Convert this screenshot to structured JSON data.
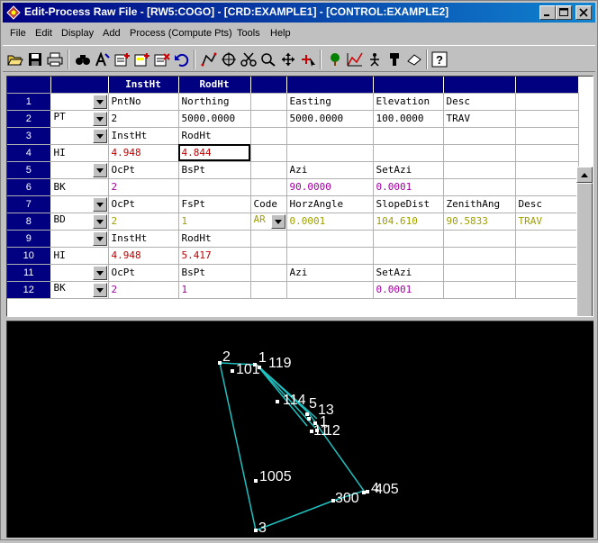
{
  "window": {
    "title": "Edit-Process Raw File - [RW5:COGO] - [CRD:EXAMPLE1] - [CONTROL:EXAMPLE2]"
  },
  "menu": [
    "File",
    "Edit",
    "Display",
    "Add",
    "Process (Compute Pts)",
    "Tools",
    "Help"
  ],
  "toolbar": [
    "open-folder-icon",
    "save-disk-icon",
    "print-icon",
    "binoculars-find-icon",
    "find-replace-icon",
    "insert-record-icon",
    "new-record-icon",
    "delete-record-icon",
    "undo-icon",
    "traverse-icon",
    "target-icon",
    "scissors-icon",
    "zoom-window-icon",
    "pan-icon",
    "pick-point-icon",
    "tree-icon",
    "process-icon",
    "person-icon",
    "rod-icon",
    "eraser-icon",
    "help-icon"
  ],
  "grid": {
    "header": [
      "",
      "",
      "InstHt",
      "RodHt",
      "",
      "",
      "",
      "",
      ""
    ],
    "rows": [
      {
        "num": "1",
        "type": "",
        "color": "black",
        "dd": true,
        "cells": [
          "PntNo",
          "Northing",
          "",
          "Easting",
          "Elevation",
          "Desc",
          ""
        ]
      },
      {
        "num": "2",
        "type": "PT",
        "color": "black",
        "dd": true,
        "cells": [
          "2",
          "5000.0000",
          "",
          "5000.0000",
          "100.0000",
          "TRAV",
          ""
        ]
      },
      {
        "num": "3",
        "type": "",
        "color": "black",
        "dd": true,
        "cells": [
          "InstHt",
          "RodHt",
          "",
          "",
          "",
          "",
          ""
        ]
      },
      {
        "num": "4",
        "type": "HI",
        "color": "red",
        "dd": false,
        "cells": [
          "4.948",
          "4.844",
          "",
          "",
          "",
          "",
          ""
        ]
      },
      {
        "num": "5",
        "type": "",
        "color": "black",
        "dd": true,
        "cells": [
          "OcPt",
          "BsPt",
          "",
          "Azi",
          "SetAzi",
          "",
          ""
        ]
      },
      {
        "num": "6",
        "type": "BK",
        "color": "mag",
        "dd": false,
        "cells": [
          "2",
          "",
          "",
          "90.0000",
          "0.0001",
          "",
          ""
        ]
      },
      {
        "num": "7",
        "type": "",
        "color": "black",
        "dd": true,
        "cells": [
          "OcPt",
          "FsPt",
          "Code",
          "HorzAngle",
          "SlopeDist",
          "ZenithAng",
          "Desc"
        ]
      },
      {
        "num": "8",
        "type": "BD",
        "color": "olive",
        "dd": true,
        "code_dd": true,
        "cells": [
          "2",
          "1",
          "AR",
          "0.0001",
          "104.610",
          "90.5833",
          "TRAV"
        ]
      },
      {
        "num": "9",
        "type": "",
        "color": "black",
        "dd": true,
        "cells": [
          "InstHt",
          "RodHt",
          "",
          "",
          "",
          "",
          ""
        ]
      },
      {
        "num": "10",
        "type": "HI",
        "color": "red",
        "dd": false,
        "cells": [
          "4.948",
          "5.417",
          "",
          "",
          "",
          "",
          ""
        ]
      },
      {
        "num": "11",
        "type": "",
        "color": "black",
        "dd": true,
        "cells": [
          "OcPt",
          "BsPt",
          "",
          "Azi",
          "SetAzi",
          "",
          ""
        ]
      },
      {
        "num": "12",
        "type": "BK",
        "color": "mag",
        "dd": true,
        "cells": [
          "2",
          "1",
          "",
          "",
          "0.0001",
          "",
          ""
        ]
      }
    ]
  },
  "plot": {
    "points": [
      {
        "label": "2"
      },
      {
        "label": "101"
      },
      {
        "label": "1"
      },
      {
        "label": "119"
      },
      {
        "label": "114"
      },
      {
        "label": "5"
      },
      {
        "label": "13"
      },
      {
        "label": "11"
      },
      {
        "label": "12"
      },
      {
        "label": "1"
      },
      {
        "label": "1005"
      },
      {
        "label": "3"
      },
      {
        "label": "300"
      },
      {
        "label": "4"
      },
      {
        "label": "405"
      }
    ]
  }
}
